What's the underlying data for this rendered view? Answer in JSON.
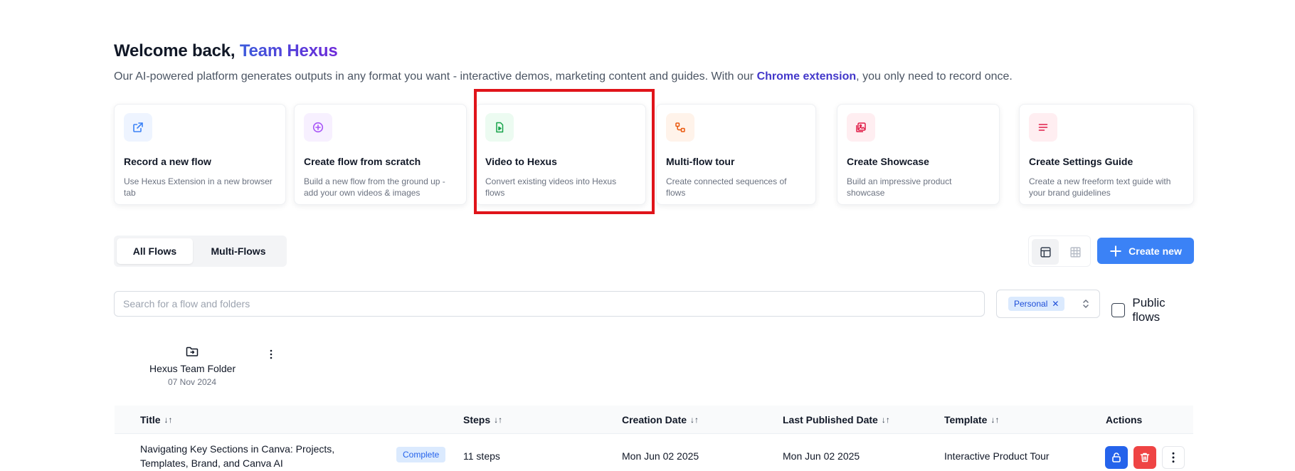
{
  "header": {
    "welcome_prefix": "Welcome back, ",
    "team_name": "Team Hexus",
    "intro_before": "Our AI-powered platform generates outputs in any format you want - interactive demos, marketing content and guides. With our ",
    "intro_link": "Chrome extension",
    "intro_after": ", you only need to record once."
  },
  "cards": [
    {
      "title": "Record a new flow",
      "desc": "Use Hexus Extension in a new browser tab",
      "icon": "external-link-icon",
      "color": "#3b82f6",
      "bg": "#eef4ff"
    },
    {
      "title": "Create flow from scratch",
      "desc": "Build a new flow from the ground up - add your own videos & images",
      "icon": "plus-circle-icon",
      "color": "#a855f7",
      "bg": "#f7f0ff"
    },
    {
      "title": "Video to Hexus",
      "desc": "Convert existing videos into Hexus flows",
      "icon": "video-file-icon",
      "color": "#16a34a",
      "bg": "#ecfbf1"
    },
    {
      "title": "Multi-flow tour",
      "desc": "Create connected sequences of flows",
      "icon": "route-icon",
      "color": "#ea580c",
      "bg": "#fff3ea"
    },
    {
      "title": "Create Showcase",
      "desc": "Build an impressive product showcase",
      "icon": "images-icon",
      "color": "#e11d48",
      "bg": "#ffeef1"
    },
    {
      "title": "Create Settings Guide",
      "desc": "Create a new freeform text guide with your brand guidelines",
      "icon": "text-lines-icon",
      "color": "#e11d48",
      "bg": "#ffeef1"
    }
  ],
  "tabs": {
    "all": "All Flows",
    "multi": "Multi-Flows"
  },
  "actions": {
    "create_new": "Create new"
  },
  "search": {
    "placeholder": "Search for a flow and folders"
  },
  "filter": {
    "chip": "Personal",
    "public_label": "Public flows"
  },
  "folder": {
    "name": "Hexus Team Folder",
    "date": "07 Nov 2024"
  },
  "table": {
    "columns": {
      "title": "Title",
      "steps": "Steps",
      "created": "Creation Date",
      "published": "Last Published Date",
      "template": "Template",
      "actions": "Actions"
    },
    "sort_glyph": "↓↑",
    "rows": [
      {
        "title": "Navigating Key Sections in Canva: Projects, Templates, Brand, and Canva AI",
        "status": "Complete",
        "steps": "11 steps",
        "created": "Mon Jun 02 2025",
        "published": "Mon Jun 02 2025",
        "template": "Interactive Product Tour"
      }
    ]
  }
}
